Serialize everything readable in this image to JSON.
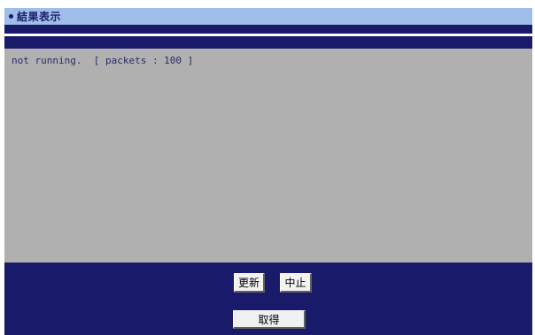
{
  "section": {
    "title": "結果表示"
  },
  "output": {
    "text": "not running.  [ packets : 100 ]"
  },
  "buttons": {
    "refresh_label": "更新",
    "stop_label": "中止",
    "get_label": "取得"
  }
}
